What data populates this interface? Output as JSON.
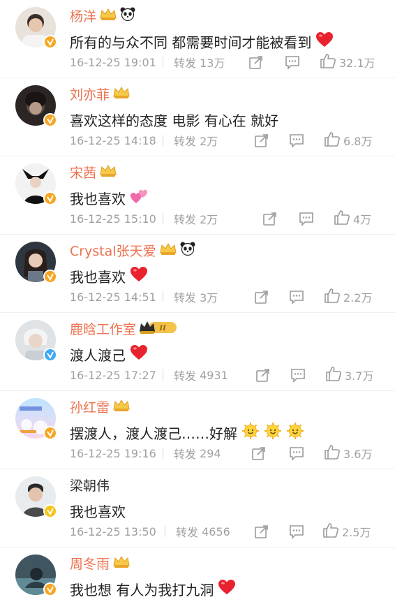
{
  "retweet_label": "转发",
  "comments": [
    {
      "user": "杨洋",
      "text": "所有的与众不同 都需要时间才能被看到",
      "emoji": "heart",
      "time": "16-12-25 19:01",
      "retweets": "13万",
      "likes": "32.1万",
      "badge": "orange",
      "crown": true,
      "panda": true
    },
    {
      "user": "刘亦菲",
      "text": "喜欢这样的态度 电影 有心在 就好",
      "emoji": "",
      "time": "16-12-25 14:18",
      "retweets": "2万",
      "likes": "6.8万",
      "badge": "orange",
      "crown": true,
      "panda": false
    },
    {
      "user": "宋茜",
      "text": "我也喜欢",
      "emoji": "twin-hearts",
      "time": "16-12-25 15:10",
      "retweets": "2万",
      "likes": "4万",
      "badge": "orange",
      "crown": true,
      "panda": false
    },
    {
      "user": "Crystal张天爱",
      "text": "我也喜欢",
      "emoji": "heart",
      "time": "16-12-25 14:51",
      "retweets": "3万",
      "likes": "2.2万",
      "badge": "orange",
      "crown": true,
      "panda": true
    },
    {
      "user": "鹿晗工作室",
      "text": "渡人渡己",
      "emoji": "heart",
      "time": "16-12-25 17:27",
      "retweets": "4931",
      "likes": "3.7万",
      "badge": "blue",
      "crown": true,
      "level": "II"
    },
    {
      "user": "孙红雷",
      "text": "摆渡人，渡人渡己……好解",
      "emoji": "three-smiles",
      "time": "16-12-25 19:16",
      "retweets": "294",
      "likes": "3.6万",
      "badge": "orange",
      "crown": true,
      "panda": false
    },
    {
      "user": "梁朝伟",
      "text": "我也喜欢",
      "emoji": "",
      "time": "16-12-25 13:50",
      "retweets": "4656",
      "likes": "2.5万",
      "badge": "yellow",
      "crown": false,
      "plain": true
    },
    {
      "user": "周冬雨",
      "text": "我也想 有人为我打九洞",
      "emoji": "heart",
      "time": "",
      "retweets": "",
      "likes": "",
      "badge": "orange",
      "crown": true,
      "panda": false
    }
  ],
  "colors": {
    "username": "#eb7350",
    "badge_orange": "#f6a623",
    "badge_blue": "#3ea8f3",
    "badge_yellow": "#f5c518",
    "meta": "#a0a0a0"
  }
}
